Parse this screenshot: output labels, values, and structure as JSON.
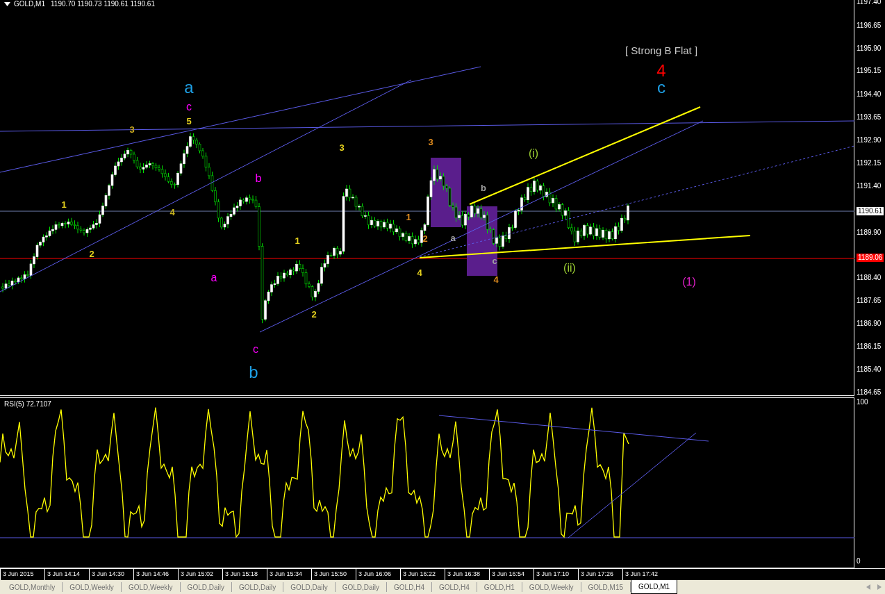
{
  "chart": {
    "symbol": "GOLD,M1",
    "quote": "1190.70 1190.73 1190.61 1190.61"
  },
  "wave_labels": [
    {
      "text": "[ Strong B Flat ]",
      "color": "#c8c8c8",
      "kind": "note"
    },
    {
      "text": "4",
      "color": "#ff0000",
      "kind": "large"
    },
    {
      "text": "c",
      "color": "#1ea0e6",
      "kind": "large"
    },
    {
      "text": "a",
      "color": "#1ea0e6",
      "kind": "large"
    },
    {
      "text": "c",
      "color": "#ff00ff",
      "kind": "medium"
    },
    {
      "text": "5",
      "color": "#e6d21e",
      "kind": "small"
    },
    {
      "text": "3",
      "color": "#c8a81e",
      "kind": "small"
    },
    {
      "text": "1",
      "color": "#e6d21e",
      "kind": "small"
    },
    {
      "text": "2",
      "color": "#e6d21e",
      "kind": "small"
    },
    {
      "text": "4",
      "color": "#c8b41e",
      "kind": "small"
    },
    {
      "text": "b",
      "color": "#ff00ff",
      "kind": "medium"
    },
    {
      "text": "a",
      "color": "#ff00ff",
      "kind": "medium"
    },
    {
      "text": "c",
      "color": "#ff00ff",
      "kind": "medium"
    },
    {
      "text": "b",
      "color": "#1ea0e6",
      "kind": "large"
    },
    {
      "text": "1",
      "color": "#e6d21e",
      "kind": "small"
    },
    {
      "text": "2",
      "color": "#e6d21e",
      "kind": "small"
    },
    {
      "text": "3",
      "color": "#e6d21e",
      "kind": "small"
    },
    {
      "text": "1",
      "color": "#e08c1e",
      "kind": "small"
    },
    {
      "text": "2",
      "color": "#e08c1e",
      "kind": "small"
    },
    {
      "text": "3",
      "color": "#e08c1e",
      "kind": "small"
    },
    {
      "text": "4",
      "color": "#e6d21e",
      "kind": "small"
    },
    {
      "text": "a",
      "color": "#a0a0a0",
      "kind": "small"
    },
    {
      "text": "b",
      "color": "#a0a0a0",
      "kind": "small"
    },
    {
      "text": "c",
      "color": "#a0a0a0",
      "kind": "small"
    },
    {
      "text": "4",
      "color": "#e08c1e",
      "kind": "small"
    },
    {
      "text": "(i)",
      "color": "#9acd32",
      "kind": "medium"
    },
    {
      "text": "(ii)",
      "color": "#9acd32",
      "kind": "medium"
    },
    {
      "text": "(1)",
      "color": "#e020c8",
      "kind": "medium"
    }
  ],
  "price_axis": {
    "ticks": [
      "1197.40",
      "1196.65",
      "1195.90",
      "1195.15",
      "1194.40",
      "1193.65",
      "1192.90",
      "1192.15",
      "1191.40",
      "1189.90",
      "1188.40",
      "1187.65",
      "1186.90",
      "1186.15",
      "1185.40",
      "1184.65"
    ],
    "current_price": "1190.61",
    "line_price": "1189.06"
  },
  "indicator": {
    "label": "RSI(5) 72.7107",
    "scale_max": "100",
    "scale_min": "0"
  },
  "time_axis": [
    "3 Jun 2015",
    "3 Jun 14:14",
    "3 Jun 14:30",
    "3 Jun 14:46",
    "3 Jun 15:02",
    "3 Jun 15:18",
    "3 Jun 15:34",
    "3 Jun 15:50",
    "3 Jun 16:06",
    "3 Jun 16:22",
    "3 Jun 16:38",
    "3 Jun 16:54",
    "3 Jun 17:10",
    "3 Jun 17:26",
    "3 Jun 17:42"
  ],
  "tabs": [
    {
      "label": "GOLD,Monthly",
      "selected": false
    },
    {
      "label": "GOLD,Weekly",
      "selected": false
    },
    {
      "label": "GOLD,Weekly",
      "selected": false
    },
    {
      "label": "GOLD,Daily",
      "selected": false
    },
    {
      "label": "GOLD,Daily",
      "selected": false
    },
    {
      "label": "GOLD,Daily",
      "selected": false
    },
    {
      "label": "GOLD,Daily",
      "selected": false
    },
    {
      "label": "GOLD,H4",
      "selected": false
    },
    {
      "label": "GOLD,H4",
      "selected": false
    },
    {
      "label": "GOLD,H1",
      "selected": false
    },
    {
      "label": "GOLD,Weekly",
      "selected": false
    },
    {
      "label": "GOLD,M15",
      "selected": false
    },
    {
      "label": "GOLD,M1",
      "selected": true
    }
  ]
}
